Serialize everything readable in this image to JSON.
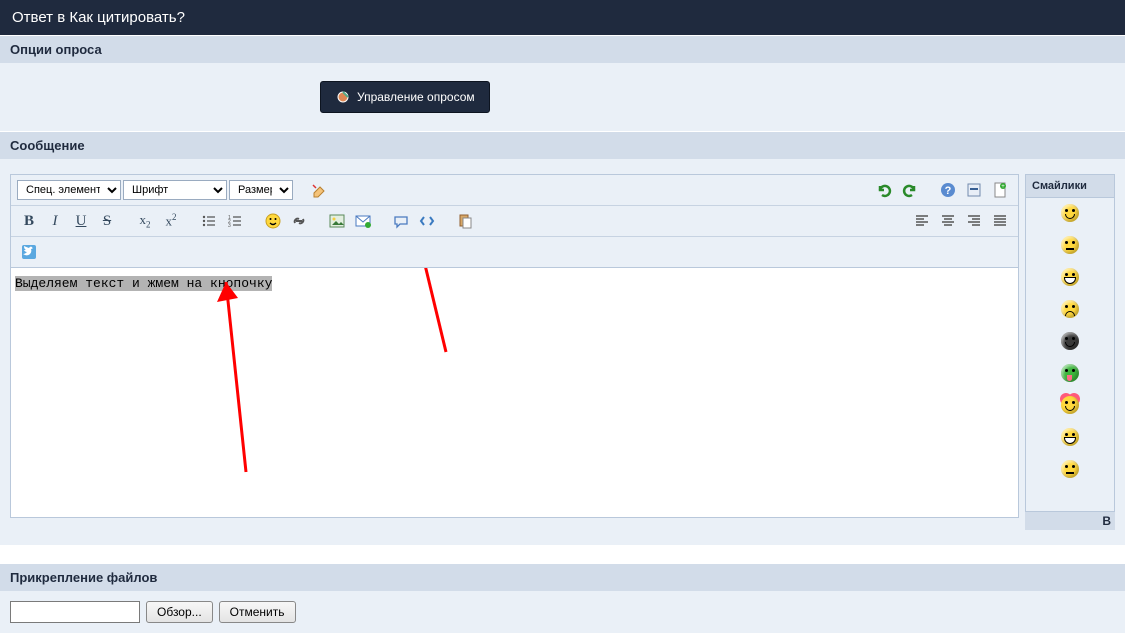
{
  "header": {
    "title": "Ответ в Как цитировать?"
  },
  "poll": {
    "section_title": "Опции опроса",
    "manage_label": "Управление опросом"
  },
  "message": {
    "section_title": "Сообщение"
  },
  "toolbar": {
    "special_label": "Спец. элементы",
    "font_label": "Шрифт",
    "size_label": "Размер"
  },
  "editor": {
    "selected_text": "Выделяем текст и жмем на кнопочку"
  },
  "smilies": {
    "title": "Смайлики",
    "more": "В"
  },
  "attach": {
    "section_title": "Прикрепление файлов",
    "browse_label": "Обзор...",
    "cancel_label": "Отменить"
  }
}
